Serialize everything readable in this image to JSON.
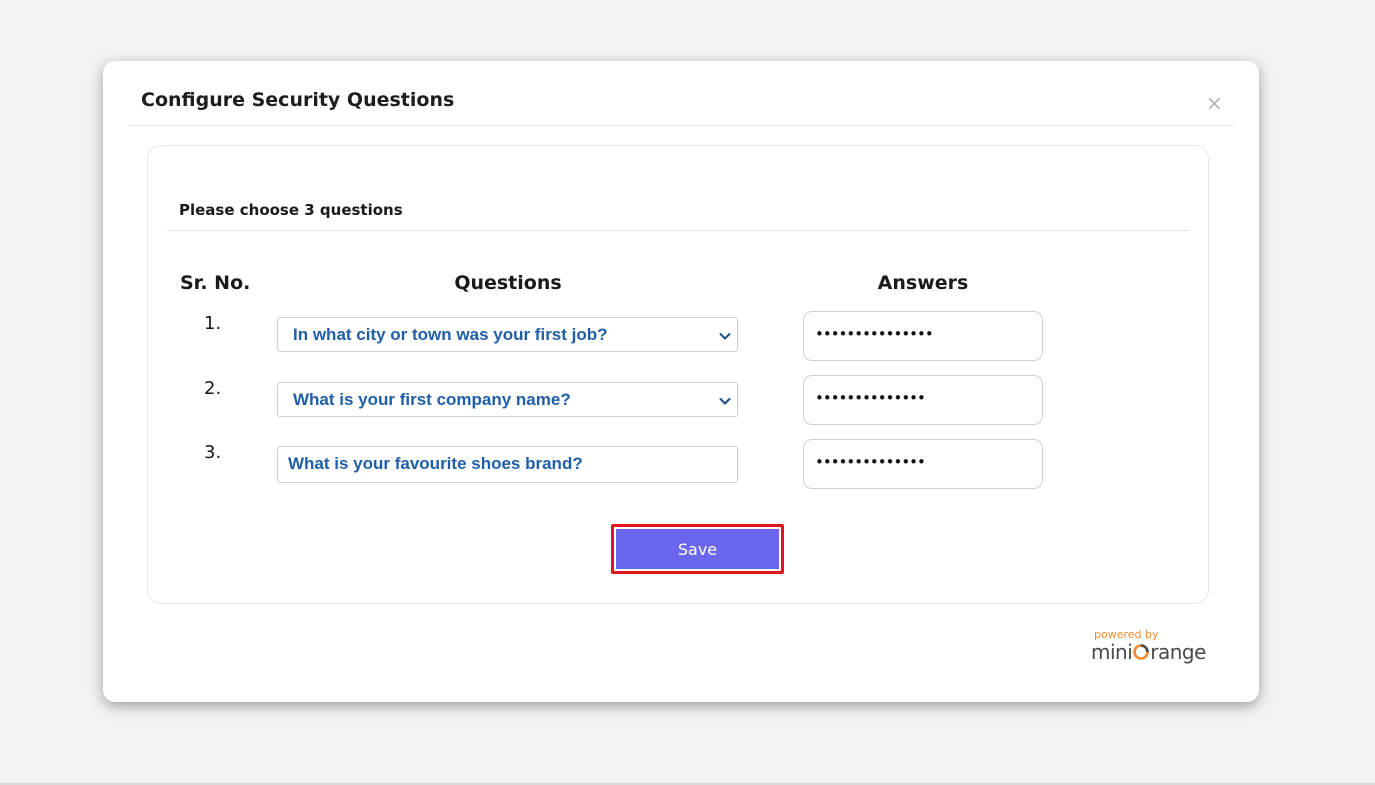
{
  "modal": {
    "title": "Configure Security Questions",
    "close_glyph": "×"
  },
  "form": {
    "instructions": "Please choose 3 questions",
    "headers": {
      "sr_no": "Sr. No.",
      "questions": "Questions",
      "answers": "Answers"
    },
    "rows": [
      {
        "number": "1.",
        "question": "In what city or town was your first job?",
        "question_type": "dropdown",
        "answer_mask": "•••••••••••••••"
      },
      {
        "number": "2.",
        "question": "What is your first company name?",
        "question_type": "dropdown",
        "answer_mask": "••••••••••••••"
      },
      {
        "number": "3.",
        "question": "What is your favourite shoes brand?",
        "question_type": "text",
        "answer_mask": "••••••••••••••"
      }
    ],
    "save_label": "Save"
  },
  "branding": {
    "powered_by": "powered by",
    "brand_name": "miniOrange",
    "brand_prefix": "mini",
    "brand_suffix": "range"
  },
  "colors": {
    "accent_button": "#6a66ef",
    "highlight_border": "#e3141b",
    "question_text": "#1f5fa8",
    "brand_orange": "#f08c2e"
  },
  "icons": {
    "close": "close-icon",
    "dropdown": "chevron-down-icon",
    "logo": "miniorange-logo-icon"
  }
}
